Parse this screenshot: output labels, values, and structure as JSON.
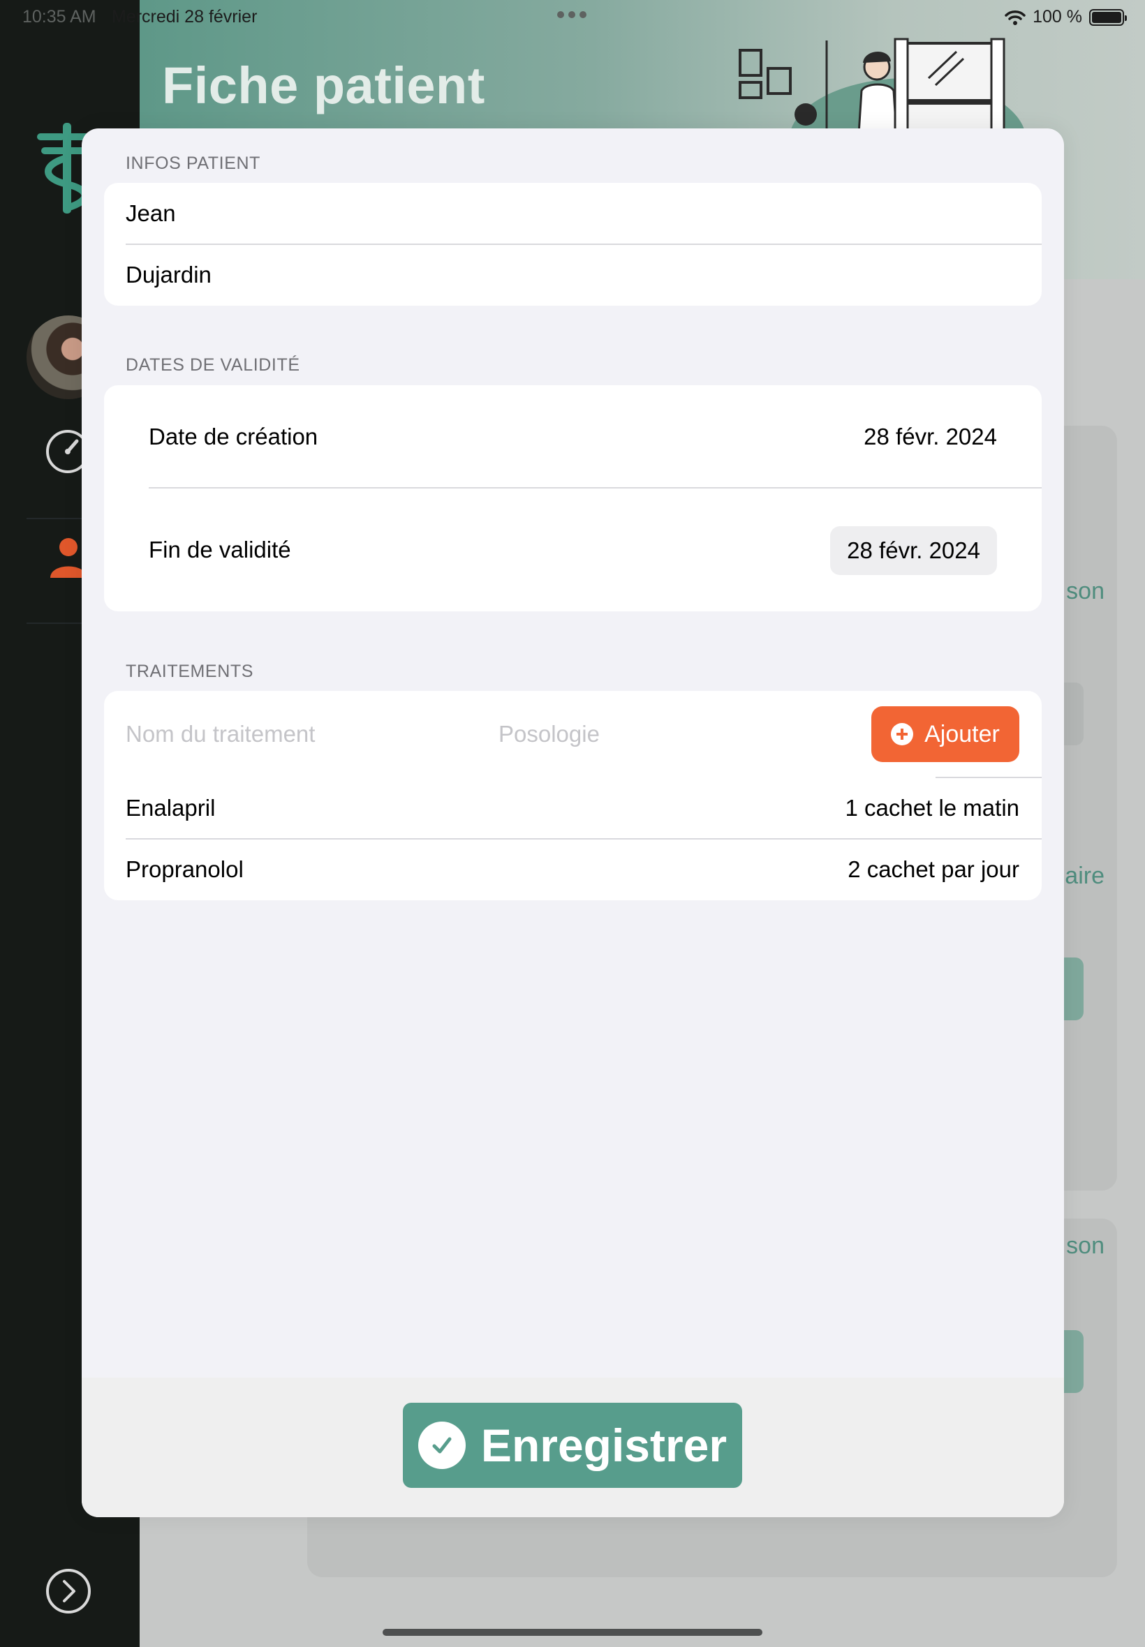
{
  "status_bar": {
    "time": "10:35 AM",
    "date": "Mercredi 28 février",
    "battery": "100 %"
  },
  "background": {
    "title": "Fiche patient",
    "card_labels": [
      "son",
      "aire",
      "son"
    ]
  },
  "sheet": {
    "patient_section": {
      "header": "INFOS PATIENT",
      "first_name": "Jean",
      "last_name": "Dujardin"
    },
    "validity_section": {
      "header": "DATES DE VALIDITÉ",
      "creation_label": "Date de création",
      "creation_value": "28 févr. 2024",
      "end_label": "Fin de validité",
      "end_value": "28 févr. 2024"
    },
    "treatments_section": {
      "header": "TRAITEMENTS",
      "name_placeholder": "Nom du traitement",
      "dosage_placeholder": "Posologie",
      "add_label": "Ajouter",
      "items": [
        {
          "name": "Enalapril",
          "dosage": "1 cachet le matin"
        },
        {
          "name": "Propranolol",
          "dosage": "2 cachet par jour"
        }
      ]
    },
    "save_label": "Enregistrer"
  },
  "colors": {
    "accent_teal": "#579d8c",
    "accent_orange": "#f26534",
    "sheet_background": "#f2f2f7"
  }
}
